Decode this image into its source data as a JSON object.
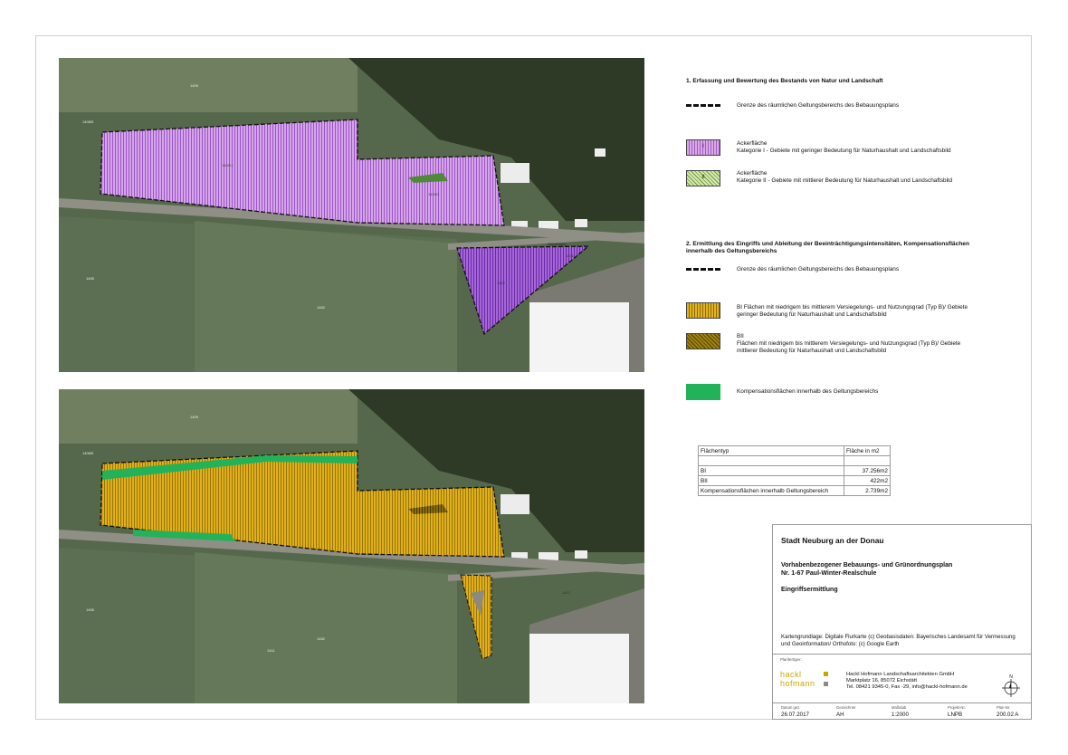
{
  "map_labels": {
    "parcel_a": "1409",
    "parcel_b": "1408/5",
    "parcel_c": "1409/1",
    "parcel_d": "1409/3",
    "parcel_e": "1401",
    "parcel_f": "1402",
    "parcel_g": "1412",
    "parcel_h": "1411",
    "parcel_i": "1455",
    "parcel_j": "1452",
    "road": "Wiesenweg"
  },
  "legend1": {
    "heading": "1. Erfassung und Bewertung des Bestands von Natur und Landschaft",
    "boundary": "Grenze des räumlichen Geltungsbereichs des Bebauungsplans",
    "acker1_mark": "I",
    "acker1_title": "Ackerfläche",
    "acker1_desc": "Kategorie I - Gebiete mit geringer Bedeutung für Naturhaushalt und Landschaftsbild",
    "acker2_mark": "II",
    "acker2_title": "Ackerfläche",
    "acker2_desc": "Kategorie II - Gebiete mit mittlerer Bedeutung für Naturhaushalt und Landschaftsbild"
  },
  "legend2": {
    "heading_line1": "2. Ermittlung des Eingriffs und Ableitung der Beeinträchtigungsintensitäten, Kompensationsflächen",
    "heading_line2": "innerhalb des Geltungsbereichs",
    "boundary": "Grenze des räumlichen Geltungsbereichs des Bebauungsplans",
    "bi_line1": "BI Flächen mit niedrigem bis mittlerem Versiegelungs- und Nutzungsgrad (Typ B)/ Gebiete",
    "bi_line2": "geringer Bedeutung für Naturhaushalt und Landschaftsbild",
    "bii_line1": "BII",
    "bii_line2": "Flächen mit niedrigem bis mittlerem Versiegelungs- und Nutzungsgrad (Typ B)/ Gebiete",
    "bii_line3": "mittlerer Bedeutung für Naturhaushalt und Landschaftsbild",
    "komp": "Kompensationsflächen innerhalb des Geltungsbereichs"
  },
  "area_table": {
    "header_type": "Flächentyp",
    "header_area": "Fläche in m2",
    "rows": [
      {
        "type": "BI",
        "area": "37.256m2"
      },
      {
        "type": "BII",
        "area": "422m2"
      },
      {
        "type": "Kompensationsflächen innerhalb Geltungsbereich",
        "area": "2.739m2"
      }
    ]
  },
  "title_block": {
    "city": "Stadt Neuburg an der Donau",
    "plan_line1": "Vorhabenbezogener Bebauungs- und Grünordnungsplan",
    "plan_line2": "Nr. 1-67 Paul-Winter-Realschule",
    "subject": "Eingriffsermittlung",
    "basis_line1": "Kartengrundlage: Digitale Flurkarte (c) Geobasisdaten: Bayerisches Landesamt für Vermessung",
    "basis_line2": "und Geoinformation/ Orthofoto: (c) Google Earth",
    "planfertiger_label": "Planfertiger:",
    "logo_line1": "hackl",
    "logo_line2": "hofmann",
    "office_line1": "Hackl Hofmann Landschaftsarchitekten GmbH",
    "office_line2": "Marktplatz 16, 85072 Eichstätt",
    "office_line3": "Tel. 08421 9345-0, Fax -29, info@hackl-hofmann.de",
    "north": "N",
    "meta": [
      {
        "label": "Datum gez.",
        "value": "26.07.2017"
      },
      {
        "label": "Gezeichnet",
        "value": "AH"
      },
      {
        "label": "Maßstab",
        "value": "1:2000"
      },
      {
        "label": "Projekt-Nr.",
        "value": "LNPB"
      },
      {
        "label": "Plan-Nr.",
        "value": "200.02 A"
      }
    ]
  },
  "colors": {
    "acker_cat1": "#c98fe0",
    "acker_cat2_road": "#8c3fc4",
    "bi": "#d9a514",
    "bii": "#7a6206",
    "kompensation": "#22b25a",
    "boundary": "#111111",
    "logo_yellow": "#c6a900",
    "logo_grey": "#8a8a8a"
  }
}
